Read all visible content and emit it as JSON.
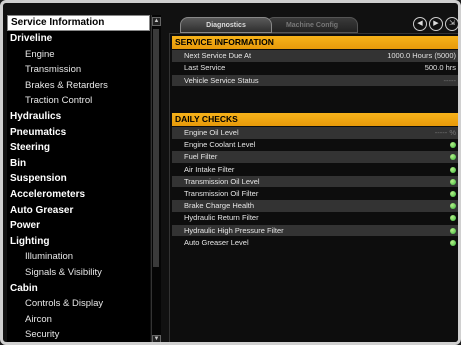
{
  "nav": {
    "items": [
      {
        "label": "Service Information",
        "level": "cat",
        "selected": true
      },
      {
        "label": "Driveline",
        "level": "cat"
      },
      {
        "label": "Engine",
        "level": "sub"
      },
      {
        "label": "Transmission",
        "level": "sub"
      },
      {
        "label": "Brakes & Retarders",
        "level": "sub"
      },
      {
        "label": "Traction Control",
        "level": "sub"
      },
      {
        "label": "Hydraulics",
        "level": "cat"
      },
      {
        "label": "Pneumatics",
        "level": "cat"
      },
      {
        "label": "Steering",
        "level": "cat"
      },
      {
        "label": "Bin",
        "level": "cat"
      },
      {
        "label": "Suspension",
        "level": "cat"
      },
      {
        "label": "Accelerometers",
        "level": "cat"
      },
      {
        "label": "Auto Greaser",
        "level": "cat"
      },
      {
        "label": "Power",
        "level": "cat"
      },
      {
        "label": "Lighting",
        "level": "cat"
      },
      {
        "label": "Illumination",
        "level": "sub"
      },
      {
        "label": "Signals & Visibility",
        "level": "sub"
      },
      {
        "label": "Cabin",
        "level": "cat"
      },
      {
        "label": "Controls & Display",
        "level": "sub"
      },
      {
        "label": "Aircon",
        "level": "sub"
      },
      {
        "label": "Security",
        "level": "sub"
      }
    ]
  },
  "tabs": {
    "active": "Diagnostics",
    "inactive": "Machine Config"
  },
  "icons": [
    "back-icon",
    "forward-icon",
    "exit-icon"
  ],
  "service": {
    "header": "SERVICE INFORMATION",
    "rows": [
      {
        "label": "Next Service Due At",
        "value": "1000.0 Hours (5000)"
      },
      {
        "label": "Last Service",
        "value": "500.0 hrs"
      },
      {
        "label": "Vehicle Service Status",
        "value": "-----"
      }
    ]
  },
  "checks": {
    "header": "DAILY CHECKS",
    "rows": [
      {
        "label": "Engine Oil Level",
        "value": "----- %",
        "status": "none"
      },
      {
        "label": "Engine Coolant Level",
        "status": "ok"
      },
      {
        "label": "Fuel Filter",
        "status": "ok"
      },
      {
        "label": "Air Intake Filter",
        "status": "ok"
      },
      {
        "label": "Transmission Oil Level",
        "status": "ok"
      },
      {
        "label": "Transmission Oil Filter",
        "status": "ok"
      },
      {
        "label": "Brake Charge Health",
        "status": "ok"
      },
      {
        "label": "Hydraulic Return Filter",
        "status": "ok"
      },
      {
        "label": "Hydraulic High Pressure Filter",
        "status": "ok"
      },
      {
        "label": "Auto Greaser Level",
        "status": "ok"
      }
    ]
  },
  "colors": {
    "accent": "#f0a412",
    "status_ok": "#4cc24a"
  }
}
